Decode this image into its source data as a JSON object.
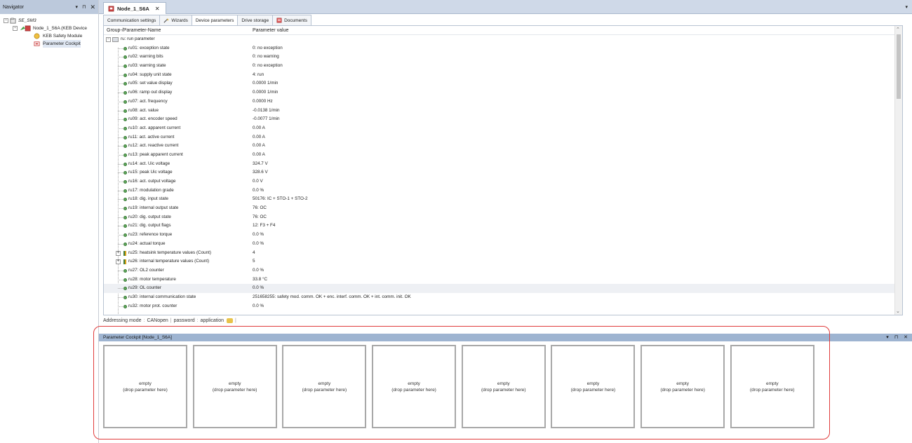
{
  "navigator": {
    "title": "Navigator",
    "controls": {
      "dropdown": "▾",
      "pin": "⊓",
      "close": "✕"
    },
    "tree": {
      "root": "SE_SM3",
      "node": "Node_1_S6A (KEB Device",
      "children": [
        "KEB Safety Module",
        "Parameter Cockpit"
      ]
    }
  },
  "document_tab": {
    "label": "Node_1_S6A",
    "close": "✕"
  },
  "tab_menu_glyph": "▾",
  "sub_tabs": [
    {
      "label": "Communication settings"
    },
    {
      "label": "Wizards"
    },
    {
      "label": "Device parameters"
    },
    {
      "label": "Drive storage"
    },
    {
      "label": "Documents"
    }
  ],
  "param_table": {
    "columns": {
      "name": "Group-/Parameter-Name",
      "value": "Parameter value"
    },
    "group": "ru: run parameter",
    "rows": [
      {
        "name": "ru01: exception state",
        "value": "0: no exception"
      },
      {
        "name": "ru02: warning bits",
        "value": "0: no warning"
      },
      {
        "name": "ru03: warning state",
        "value": "0: no exception"
      },
      {
        "name": "ru04: supply unit state",
        "value": "4: run"
      },
      {
        "name": "ru05: set value display",
        "value": "0.0000 1/min"
      },
      {
        "name": "ru06: ramp out display",
        "value": "0.0000 1/min"
      },
      {
        "name": "ru07: act. frequency",
        "value": "0.0000 Hz"
      },
      {
        "name": "ru08: act. value",
        "value": "-0.0138 1/min"
      },
      {
        "name": "ru09: act. encoder speed",
        "value": "-0.0077 1/min"
      },
      {
        "name": "ru10: act. apparent current",
        "value": "0.00 A"
      },
      {
        "name": "ru11: act. active current",
        "value": "0.00 A"
      },
      {
        "name": "ru12: act. reactive current",
        "value": "0.00 A"
      },
      {
        "name": "ru13: peak apparent current",
        "value": "0.00 A"
      },
      {
        "name": "ru14: act. Uic voltage",
        "value": "324.7 V"
      },
      {
        "name": "ru15: peak Uic voltage",
        "value": "328.6 V"
      },
      {
        "name": "ru16: act. output voltage",
        "value": "0.0 V"
      },
      {
        "name": "ru17: modulation grade",
        "value": "0.0 %"
      },
      {
        "name": "ru18: dig. input state",
        "value": "50176: IC + STO-1 + STO-2"
      },
      {
        "name": "ru19: internal output state",
        "value": "76: OC"
      },
      {
        "name": "ru20: dig. output state",
        "value": "76: OC"
      },
      {
        "name": "ru21: dig. output flags",
        "value": "12: F3 + F4"
      },
      {
        "name": "ru23: reference torque",
        "value": "0.0 %"
      },
      {
        "name": "ru24: actual torque",
        "value": "0.0 %"
      },
      {
        "name": "ru25: heatsink temperature values (Count)",
        "value": "4",
        "array": true
      },
      {
        "name": "ru26: internal temperature values (Count)",
        "value": "5",
        "array": true
      },
      {
        "name": "ru27: OL2 counter",
        "value": "0.0 %"
      },
      {
        "name": "ru28: motor temperature",
        "value": "33.8 °C"
      },
      {
        "name": "ru29: OL counter",
        "value": "0.0 %",
        "highlight": true
      },
      {
        "name": "ru30: internal communication state",
        "value": "251658255: safety mod. comm. OK + enc. interf. comm. OK + int. comm. init. OK"
      },
      {
        "name": "ru32: motor prot. counter",
        "value": "0.0 %"
      }
    ]
  },
  "addressing_bar": {
    "label": "Addressing mode",
    "mode": "CANopen",
    "password_label": "password",
    "password_value": "application"
  },
  "cockpit": {
    "title": "Parameter Cockpit [Node_1_S6A]",
    "controls": {
      "dropdown": "▾",
      "pin": "⊓",
      "close": "✕"
    },
    "slots": [
      {
        "line1": "empty",
        "line2": "(drop parameter here)"
      },
      {
        "line1": "empty",
        "line2": "(drop parameter here)"
      },
      {
        "line1": "empty",
        "line2": "(drop parameter here)"
      },
      {
        "line1": "empty",
        "line2": "(drop parameter here)"
      },
      {
        "line1": "empty",
        "line2": "(drop parameter here)"
      },
      {
        "line1": "empty",
        "line2": "(drop parameter here)"
      },
      {
        "line1": "empty",
        "line2": "(drop parameter here)"
      },
      {
        "line1": "empty",
        "line2": "(drop parameter here)"
      }
    ]
  },
  "colors": {
    "header_bg": "#bcc9dc",
    "cockpit_header_bg": "#9eb4d1",
    "highlight_border": "#e03c3c"
  }
}
